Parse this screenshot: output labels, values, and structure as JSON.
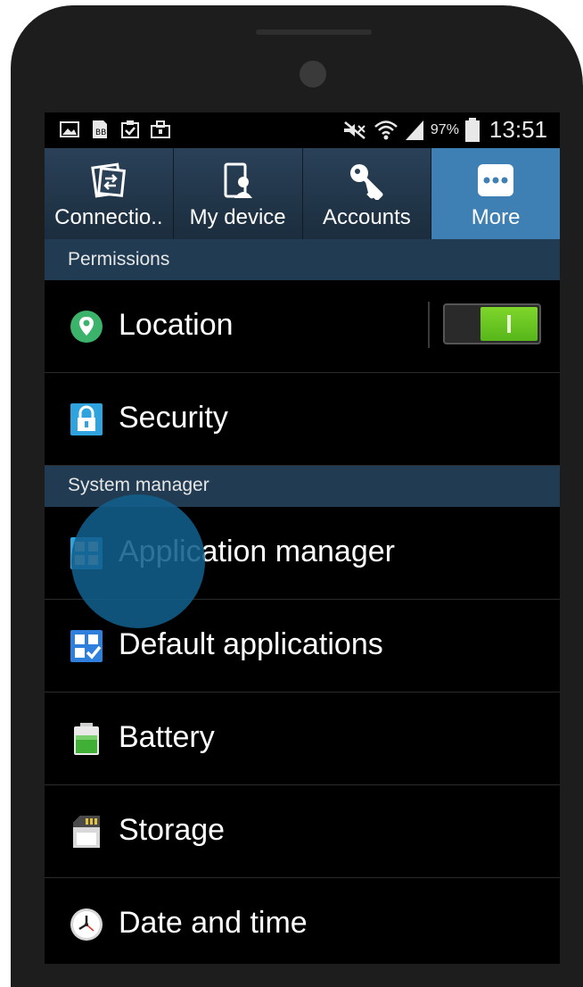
{
  "status_bar": {
    "battery_percent": "97%",
    "time": "13:51",
    "icons_left": [
      "gallery-icon",
      "bbm-icon",
      "clipboard-check-icon",
      "briefcase-icon"
    ],
    "icons_right": [
      "mute-icon",
      "wifi-icon",
      "signal-icon",
      "battery-icon"
    ]
  },
  "tabs": [
    {
      "label": "Connectio..",
      "icon": "connections-icon",
      "active": false
    },
    {
      "label": "My device",
      "icon": "my-device-icon",
      "active": false
    },
    {
      "label": "Accounts",
      "icon": "key-icon",
      "active": false
    },
    {
      "label": "More",
      "icon": "more-icon",
      "active": true
    }
  ],
  "sections": [
    {
      "title": "Permissions",
      "items": [
        {
          "label": "Location",
          "icon": "location-icon",
          "toggle_on": true
        },
        {
          "label": "Security",
          "icon": "lock-icon"
        }
      ]
    },
    {
      "title": "System manager",
      "items": [
        {
          "label": "Application manager",
          "icon": "apps-grid-icon"
        },
        {
          "label": "Default applications",
          "icon": "default-apps-icon"
        },
        {
          "label": "Battery",
          "icon": "battery-icon"
        },
        {
          "label": "Storage",
          "icon": "sd-card-icon"
        },
        {
          "label": "Date and time",
          "icon": "clock-icon"
        }
      ]
    }
  ],
  "colors": {
    "tab_active": "#3e7fb4",
    "section_header": "#213c52",
    "toggle_on": "#66c21f",
    "touch_highlight": "#115f8c"
  }
}
